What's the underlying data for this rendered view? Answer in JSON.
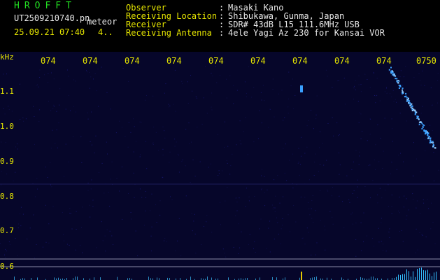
{
  "header": {
    "app_title": "HROFFT",
    "filename": "UT2509210740.pn",
    "mode": "meteor",
    "datetime": "25.09.21 07:40",
    "count": "4..",
    "fields": [
      {
        "label": "Observer",
        "value": "Masaki Kano"
      },
      {
        "label": "Receiving Location",
        "value": "Shibukawa, Gunma, Japan"
      },
      {
        "label": "Receiver",
        "value": "SDR# 43dB L15 111.6MHz USB"
      },
      {
        "label": "Receiving Antenna",
        "value": "4ele Yagi Az 230 for Kansai VOR"
      }
    ]
  },
  "spectrogram": {
    "unit": "kHz",
    "freq_labels": [
      "1.1",
      "1.0",
      "0.9",
      "0.8",
      "0.7",
      "0.6"
    ],
    "time_labels": [
      "074",
      "074",
      "074",
      "074",
      "074",
      "074",
      "074",
      "074",
      "074",
      "0750"
    ],
    "colors": {
      "background": "#06062a",
      "label": "#e6e600",
      "trace": "#3aa0ff",
      "baseline": "#8a8aa8"
    }
  }
}
